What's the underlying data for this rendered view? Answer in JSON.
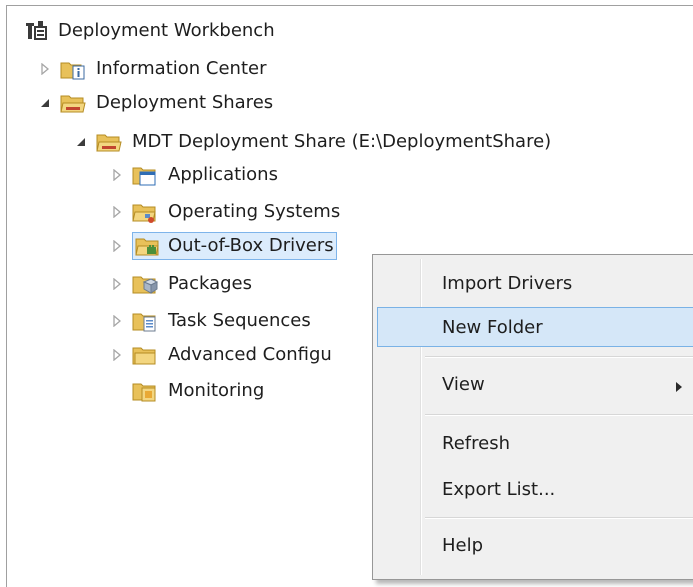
{
  "tree": {
    "root": "Deployment Workbench",
    "information_center": "Information Center",
    "deployment_shares": "Deployment Shares",
    "share": "MDT Deployment Share (E:\\DeploymentShare)",
    "applications": "Applications",
    "operating_systems": "Operating Systems",
    "drivers": "Out-of-Box Drivers",
    "packages": "Packages",
    "task_sequences": "Task Sequences",
    "advanced": "Advanced Configu",
    "monitoring": "Monitoring"
  },
  "context_menu": {
    "import_drivers": "Import Drivers",
    "new_folder": "New Folder",
    "view": "View",
    "refresh": "Refresh",
    "export_list": "Export List...",
    "help": "Help"
  },
  "colors": {
    "selection": "#dcecfc",
    "selection_border": "#7eb4ea",
    "menu_background": "#f0f0f0",
    "menu_highlight": "#d5e7f8",
    "folder": "#e8c15a"
  }
}
